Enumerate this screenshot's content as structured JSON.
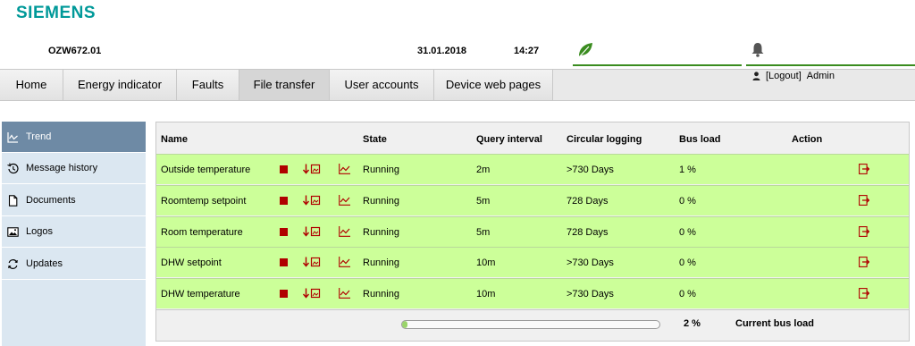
{
  "brand": {
    "logo": "SIEMENS",
    "color": "#009999"
  },
  "header": {
    "device": "OZW672.01",
    "date": "31.01.2018",
    "time": "14:27",
    "status_icon": "leaf-icon",
    "alarm_icon": "bell-icon"
  },
  "nav": {
    "tabs": [
      {
        "label": "Home"
      },
      {
        "label": "Energy indicator"
      },
      {
        "label": "Faults"
      },
      {
        "label": "File transfer",
        "active": true
      },
      {
        "label": "User accounts"
      },
      {
        "label": "Device web pages"
      }
    ]
  },
  "user": {
    "logout": "[Logout]",
    "name": "Admin"
  },
  "sidebar": {
    "items": [
      {
        "label": "Trend",
        "icon": "trend-icon",
        "active": true
      },
      {
        "label": "Message history",
        "icon": "history-icon"
      },
      {
        "label": "Documents",
        "icon": "document-icon"
      },
      {
        "label": "Logos",
        "icon": "image-icon"
      },
      {
        "label": "Updates",
        "icon": "refresh-icon"
      }
    ]
  },
  "table": {
    "headers": {
      "name": "Name",
      "state": "State",
      "query": "Query interval",
      "circular": "Circular logging",
      "bus": "Bus load",
      "action": "Action"
    },
    "rows": [
      {
        "name": "Outside temperature",
        "state": "Running",
        "query": "2m",
        "circular": ">730 Days",
        "bus": "1 %"
      },
      {
        "name": "Roomtemp setpoint",
        "state": "Running",
        "query": "5m",
        "circular": "728 Days",
        "bus": "0 %"
      },
      {
        "name": "Room temperature",
        "state": "Running",
        "query": "5m",
        "circular": "728 Days",
        "bus": "0 %"
      },
      {
        "name": "DHW setpoint",
        "state": "Running",
        "query": "10m",
        "circular": ">730 Days",
        "bus": "0 %"
      },
      {
        "name": "DHW temperature",
        "state": "Running",
        "query": "10m",
        "circular": ">730 Days",
        "bus": "0 %"
      }
    ],
    "row_color": "#ccff99",
    "icon_color": "#b00000"
  },
  "footer": {
    "bus_load_percent": "2 %",
    "bus_load_fraction": 0.02,
    "bus_load_label": "Current bus load"
  }
}
